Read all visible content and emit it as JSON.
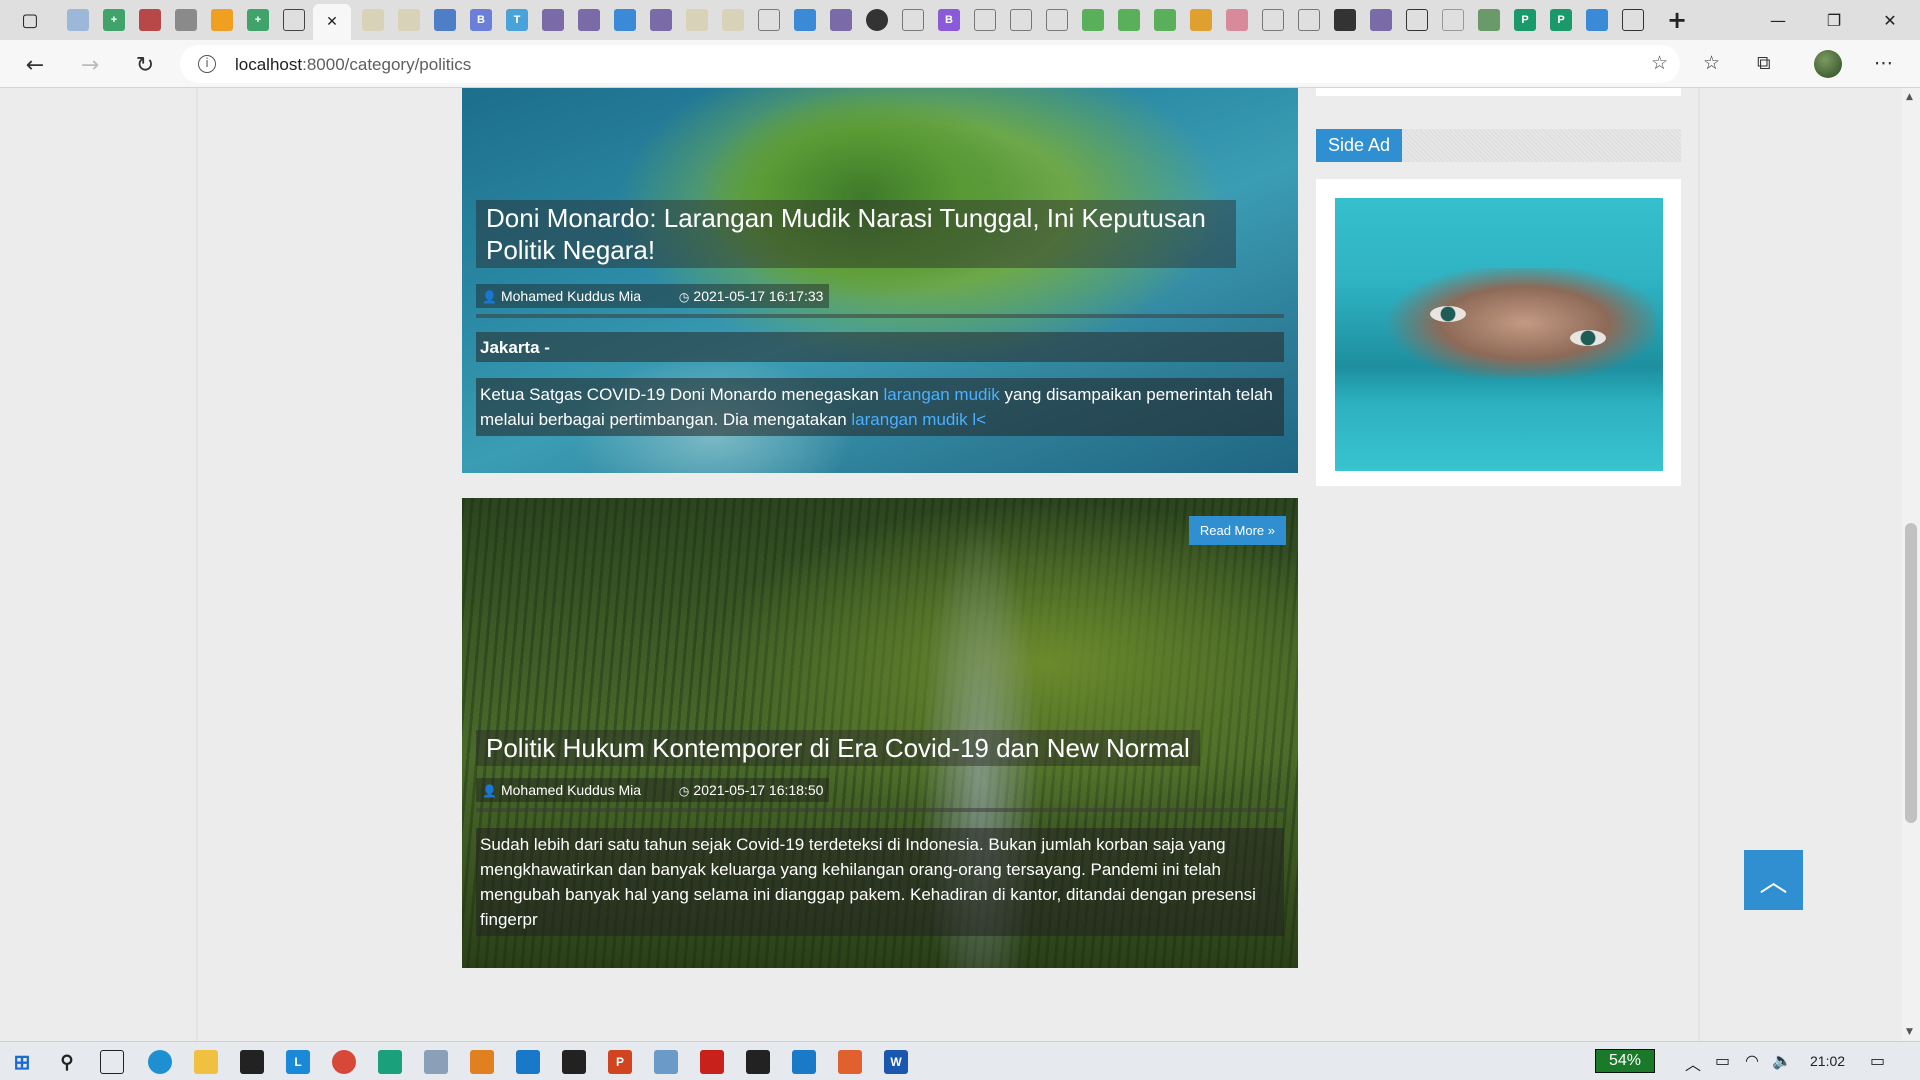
{
  "browser": {
    "tab_strip_icons": [
      "menu-icon",
      "edge-icon",
      "add-icon",
      "mail-icon",
      "ext-icon",
      "pma-icon",
      "add-icon",
      "page-icon"
    ],
    "active_tab_close": "✕",
    "new_tab": "+",
    "url_host": "localhost",
    "url_path": ":8000/category/politics",
    "window": {
      "minimize": "—",
      "maximize": "❐",
      "close": "✕"
    }
  },
  "page": {
    "articles": [
      {
        "title": "Doni Monardo: Larangan Mudik Narasi Tunggal, Ini Keputusan Politik Negara!",
        "author": "Mohamed Kuddus Mia",
        "date": "2021-05-17 16:17:33",
        "dateline": "Jakarta -",
        "excerpt_part1": "Ketua Satgas COVID-19 Doni Monardo menegaskan ",
        "excerpt_link1": "larangan mudik",
        "excerpt_part2": " yang disampaikan pemerintah telah melalui berbagai pertimbangan. Dia mengatakan ",
        "excerpt_link2": "larangan mudik l<"
      },
      {
        "title": "Politik Hukum Kontemporer di Era Covid-19 dan New Normal",
        "author": "Mohamed Kuddus Mia",
        "date": "2021-05-17 16:18:50",
        "read_more": "Read More »",
        "excerpt": "Sudah lebih dari satu tahun sejak Covid-19 terdeteksi di Indonesia. Bukan jumlah korban saja yang mengkhawatirkan dan banyak keluarga yang kehilangan orang-orang tersayang. Pandemi ini telah mengubah banyak hal yang selama ini dianggap pakem. Kehadiran di kantor, ditandai dengan presensi fingerpr"
      }
    ],
    "sidebar": {
      "widget_title": "Side Ad"
    },
    "back_to_top": "︿"
  },
  "taskbar": {
    "battery_percent": "54%",
    "time": "21:02"
  },
  "colors": {
    "accent": "#2f8fd0",
    "link": "#4ab0ff"
  }
}
